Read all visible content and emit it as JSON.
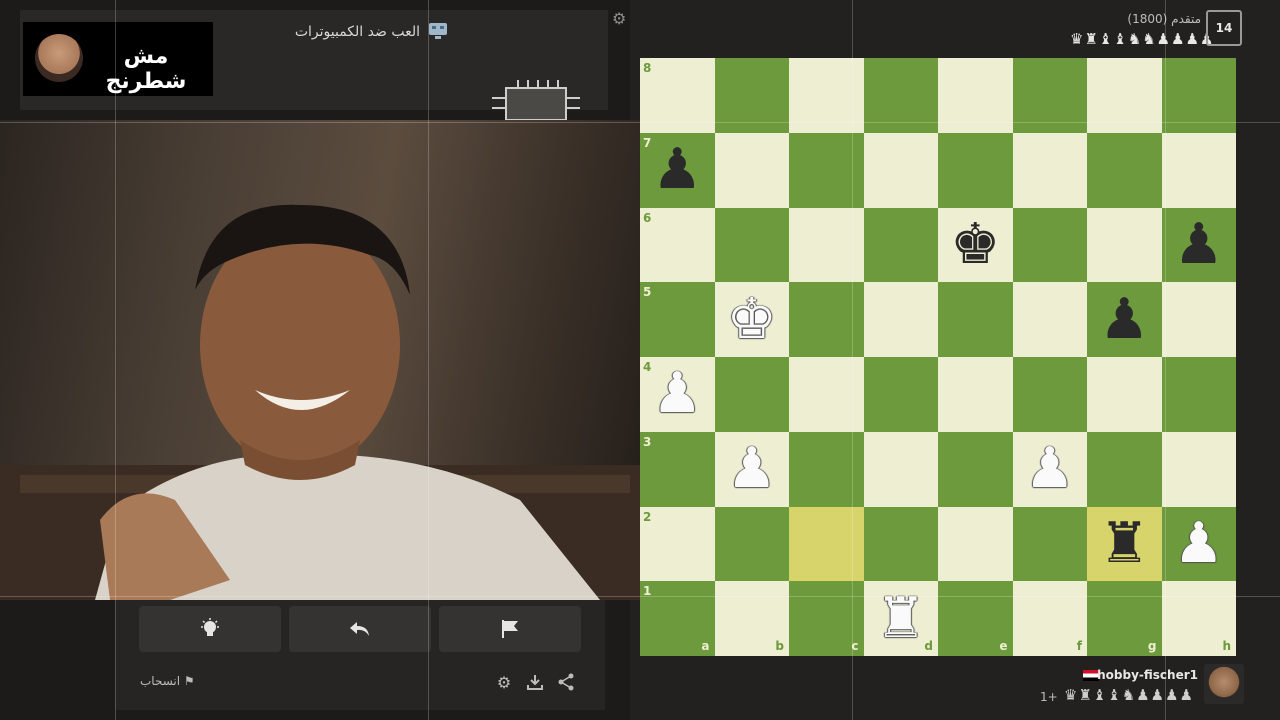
{
  "header": {
    "mode_title": "العب ضد الكمبيوترات",
    "channel_name": "مش شطرنج"
  },
  "opponent": {
    "name": "متقدم (1800)",
    "chip_number": "14",
    "captured": "♛♜♝♝♞♞♟♟♟♟"
  },
  "player": {
    "name": "hobby-fischer1",
    "score": "1+",
    "captured": "♛♜♝♝♞♟♟♟♟"
  },
  "board": {
    "ranks": [
      "8",
      "7",
      "6",
      "5",
      "4",
      "3",
      "2",
      "1"
    ],
    "files": [
      "a",
      "b",
      "c",
      "d",
      "e",
      "f",
      "g",
      "h"
    ],
    "highlighted": [
      "c2",
      "g2"
    ],
    "pieces": [
      {
        "square": "a7",
        "glyph": "♟",
        "color": "black"
      },
      {
        "square": "e6",
        "glyph": "♚",
        "color": "black"
      },
      {
        "square": "h6",
        "glyph": "♟",
        "color": "black"
      },
      {
        "square": "b5",
        "glyph": "♚",
        "color": "white"
      },
      {
        "square": "g5",
        "glyph": "♟",
        "color": "black"
      },
      {
        "square": "a4",
        "glyph": "♟",
        "color": "white"
      },
      {
        "square": "b3",
        "glyph": "♟",
        "color": "white"
      },
      {
        "square": "f3",
        "glyph": "♟",
        "color": "white"
      },
      {
        "square": "g2",
        "glyph": "♜",
        "color": "black"
      },
      {
        "square": "h2",
        "glyph": "♟",
        "color": "white"
      },
      {
        "square": "d1",
        "glyph": "♜",
        "color": "white"
      }
    ]
  },
  "controls": {
    "hint_icon": "lightbulb-icon",
    "undo_icon": "undo-arrow-icon",
    "resign_flag_icon": "flag-icon",
    "resign_label": "انسحاب",
    "settings_icon": "gear-icon",
    "download_icon": "download-icon",
    "share_icon": "share-icon"
  },
  "colors": {
    "light_square": "#eeeed2",
    "dark_square": "#6d9a3c",
    "highlight": "#d6d46a"
  }
}
